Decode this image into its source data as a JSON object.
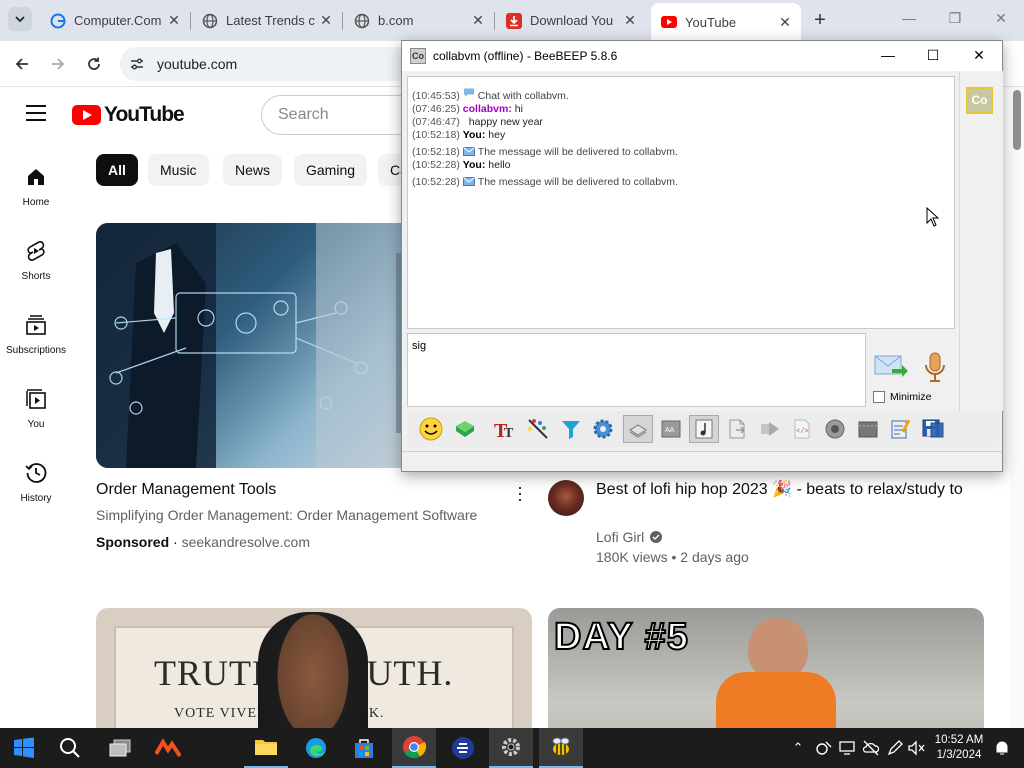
{
  "browser": {
    "tabs": [
      {
        "label": "Computer.Com",
        "icon": "globe-g-icon"
      },
      {
        "label": "Latest Trends c",
        "icon": "globe-icon"
      },
      {
        "label": "b.com",
        "icon": "globe-icon"
      },
      {
        "label": "Download You",
        "icon": "download-icon"
      },
      {
        "label": "YouTube",
        "icon": "youtube-icon"
      }
    ],
    "url": "youtube.com"
  },
  "youtube": {
    "logo_text": "YouTube",
    "search_placeholder": "Search",
    "sidebar": [
      {
        "label": "Home",
        "icon": "home-icon"
      },
      {
        "label": "Shorts",
        "icon": "shorts-icon"
      },
      {
        "label": "Subscriptions",
        "icon": "subscriptions-icon"
      },
      {
        "label": "You",
        "icon": "you-icon"
      },
      {
        "label": "History",
        "icon": "history-icon"
      }
    ],
    "chips": [
      "All",
      "Music",
      "News",
      "Gaming",
      "Ca"
    ],
    "videos": [
      {
        "title": "Order Management Tools",
        "description": "Simplifying Order Management: Order Management Software",
        "sponsored": "Sponsored",
        "sep": " · ",
        "domain": "seekandresolve.com"
      },
      {
        "title": "Best of lofi hip hop 2023 🎉 - beats to relax/study to",
        "channel": "Lofi Girl",
        "meta": "180K views • 2 days ago"
      }
    ],
    "thumb_texts": {
      "truth": "TRUTH.   TRUTH.",
      "vote": "VOTE VIVEK.   VOTE VIVEK.",
      "day": "DAY #5"
    }
  },
  "beebeep": {
    "title": "collabvm (offline) - BeeBEEP 5.8.6",
    "icon_text": "Co",
    "avatar_text": "Co",
    "messages": [
      {
        "ts": "(10:45:53)",
        "sender": "",
        "text": "Chat with collabvm.",
        "kind": "system"
      },
      {
        "ts": "(07:46:25)",
        "sender": "collabvm:",
        "text": "hi",
        "kind": "peer"
      },
      {
        "ts": "(07:46:47)",
        "sender": "",
        "text": "happy new year",
        "kind": "cont"
      },
      {
        "ts": "(10:52:18)",
        "sender": "You:",
        "text": "hey",
        "kind": "me"
      },
      {
        "ts": "(10:52:18)",
        "sender": "",
        "text": "The message will be delivered to collabvm.",
        "kind": "mail"
      },
      {
        "ts": "(10:52:28)",
        "sender": "You:",
        "text": "hello",
        "kind": "me"
      },
      {
        "ts": "(10:52:28)",
        "sender": "",
        "text": "The message will be delivered to collabvm.",
        "kind": "mail"
      }
    ],
    "input_text": "sig",
    "minimize_label": "Minimize"
  },
  "taskbar": {
    "time": "10:52 AM",
    "date": "1/3/2024"
  },
  "colors": {
    "youtube_red": "#ff0000",
    "peer_name": "#a000c8",
    "taskbar": "#1c1c1c"
  }
}
